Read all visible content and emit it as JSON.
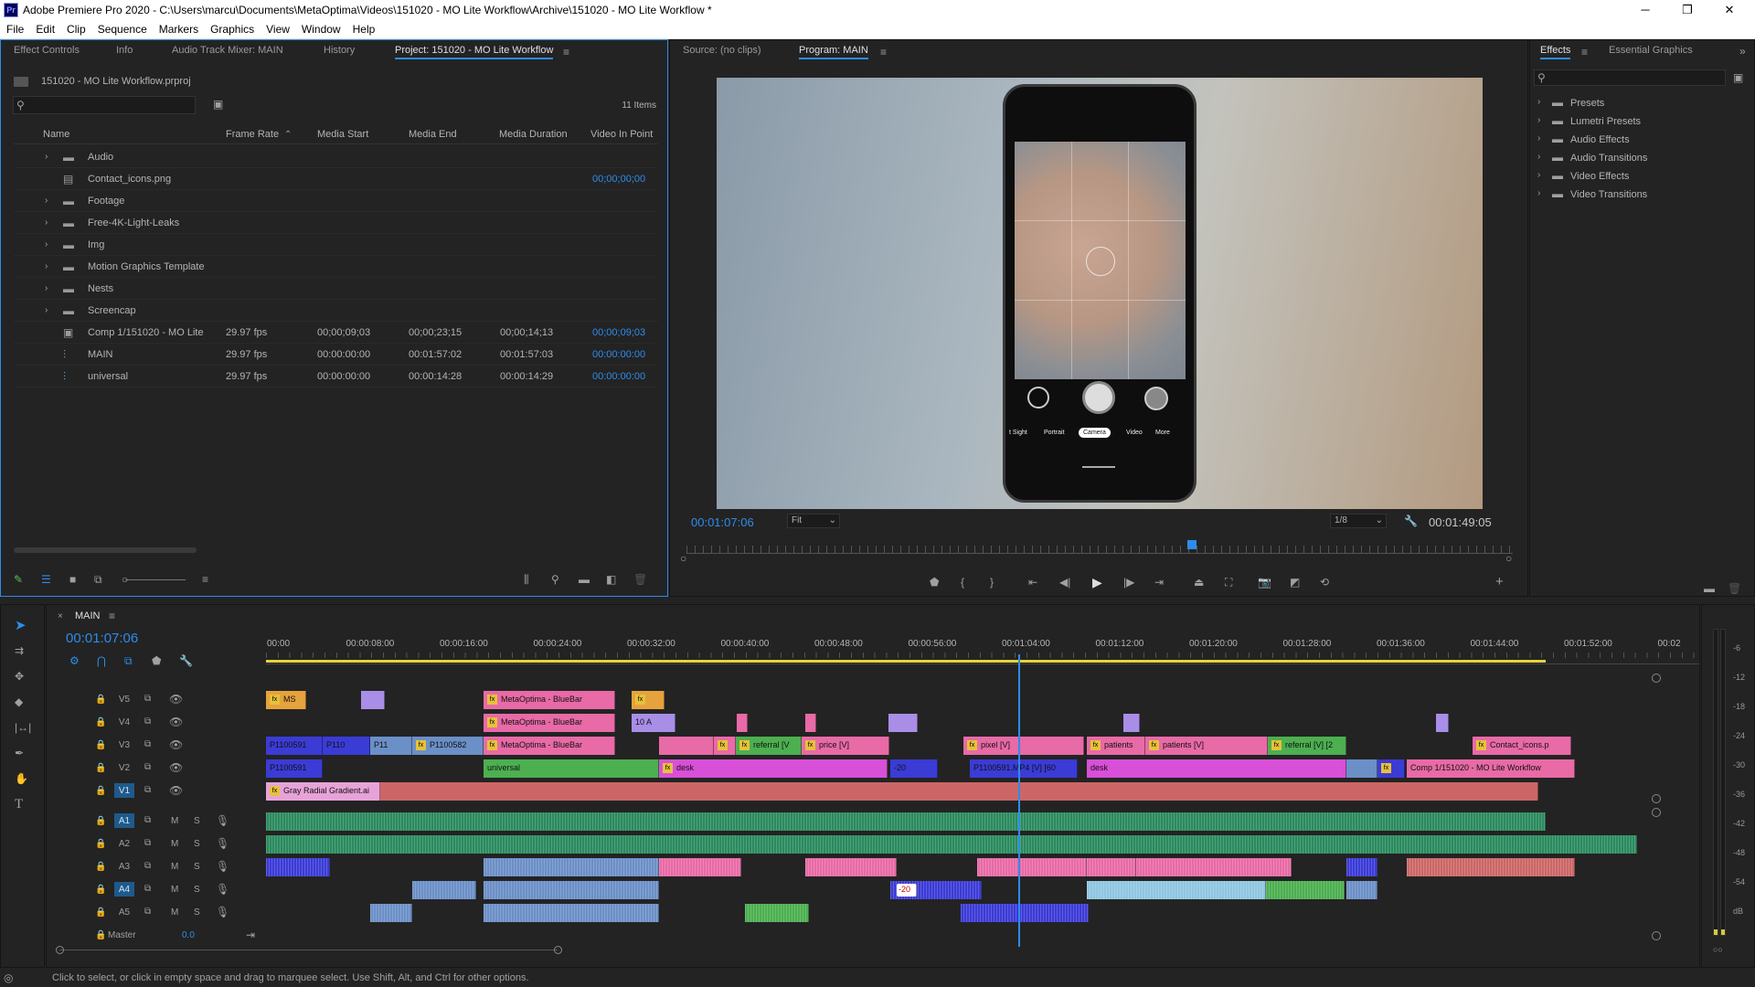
{
  "titlebar": {
    "app_icon": "Pr",
    "title": "Adobe Premiere Pro 2020 - C:\\Users\\marcu\\Documents\\MetaOptima\\Videos\\151020 - MO Lite Workflow\\Archive\\151020 - MO Lite Workflow *",
    "minimize": "─",
    "maximize": "❐",
    "close": "✕"
  },
  "menu": [
    "File",
    "Edit",
    "Clip",
    "Sequence",
    "Markers",
    "Graphics",
    "View",
    "Window",
    "Help"
  ],
  "left_panel": {
    "tabs": [
      "Effect Controls",
      "Info",
      "Audio Track Mixer: MAIN",
      "History",
      "Project: 151020 - MO Lite Workflow"
    ],
    "active_tab": "Project: 151020 - MO Lite Workflow",
    "project_file": "151020 - MO Lite Workflow.prproj",
    "search_placeholder": "",
    "item_count": "11 Items",
    "columns": [
      "Name",
      "Frame Rate",
      "Media Start",
      "Media End",
      "Media Duration",
      "Video In Point"
    ],
    "rows": [
      {
        "name": "Audio",
        "type": "folder",
        "frame_rate": "",
        "start": "",
        "end": "",
        "duration": "",
        "in_point": ""
      },
      {
        "name": "Contact_icons.png",
        "type": "image",
        "frame_rate": "",
        "start": "",
        "end": "",
        "duration": "",
        "in_point": "00;00;00;00"
      },
      {
        "name": "Footage",
        "type": "folder",
        "frame_rate": "",
        "start": "",
        "end": "",
        "duration": "",
        "in_point": ""
      },
      {
        "name": "Free-4K-Light-Leaks",
        "type": "folder",
        "frame_rate": "",
        "start": "",
        "end": "",
        "duration": "",
        "in_point": ""
      },
      {
        "name": "Img",
        "type": "folder",
        "frame_rate": "",
        "start": "",
        "end": "",
        "duration": "",
        "in_point": ""
      },
      {
        "name": "Motion Graphics Template",
        "type": "folder",
        "frame_rate": "",
        "start": "",
        "end": "",
        "duration": "",
        "in_point": ""
      },
      {
        "name": "Nests",
        "type": "folder",
        "frame_rate": "",
        "start": "",
        "end": "",
        "duration": "",
        "in_point": ""
      },
      {
        "name": "Screencap",
        "type": "folder",
        "frame_rate": "",
        "start": "",
        "end": "",
        "duration": "",
        "in_point": ""
      },
      {
        "name": "Comp 1/151020 - MO Lite",
        "type": "comp",
        "frame_rate": "29.97 fps",
        "start": "00;00;09;03",
        "end": "00;00;23;15",
        "duration": "00;00;14;13",
        "in_point": "00;00;09;03"
      },
      {
        "name": "MAIN",
        "type": "sequence",
        "frame_rate": "29.97 fps",
        "start": "00:00:00:00",
        "end": "00:01:57:02",
        "duration": "00:01:57:03",
        "in_point": "00:00:00:00"
      },
      {
        "name": "universal",
        "type": "sequence",
        "frame_rate": "29.97 fps",
        "start": "00:00:00:00",
        "end": "00:00:14:28",
        "duration": "00:00:14:29",
        "in_point": "00:00:00:00"
      }
    ]
  },
  "program": {
    "tabs": [
      "Source: (no clips)",
      "Program: MAIN"
    ],
    "active_tab": "Program: MAIN",
    "timecode": "00:01:07:06",
    "fit": "Fit",
    "resolution": "1/8",
    "duration": "00:01:49:05",
    "phone_modes": [
      "t Sight",
      "Portrait",
      "Camera",
      "Video",
      "More"
    ],
    "playhead_fraction": 0.612
  },
  "effects": {
    "tabs": [
      "Effects",
      "Essential Graphics"
    ],
    "active_tab": "Effects",
    "items": [
      "Presets",
      "Lumetri Presets",
      "Audio Effects",
      "Audio Transitions",
      "Video Effects",
      "Video Transitions"
    ]
  },
  "timeline": {
    "sequence": "MAIN",
    "timecode": "00:01:07:06",
    "ruler": [
      "00:00",
      "00:00:08:00",
      "00:00:16:00",
      "00:00:24:00",
      "00:00:32:00",
      "00:00:40:00",
      "00:00:48:00",
      "00:00:56:00",
      "00:01:04:00",
      "00:01:12:00",
      "00:01:20:00",
      "00:01:28:00",
      "00:01:36:00",
      "00:01:44:00",
      "00:01:52:00",
      "00:02"
    ],
    "video_tracks": [
      "V5",
      "V4",
      "V3",
      "V2",
      "V1"
    ],
    "audio_tracks": [
      "A1",
      "A2",
      "A3",
      "A4",
      "A5"
    ],
    "master_label": "Master",
    "master_value": "0.0",
    "clips": {
      "v5_ms": "MS",
      "v5_bluebar": "MetaOptima - BlueBar",
      "v4_bluebar": "MetaOptima - BlueBar",
      "v4_10a": "10 A",
      "v3_p1": "P1100591",
      "v3_p2": "P110",
      "v3_p3": "P11",
      "v3_p4": "P1100582",
      "v3_bluebar": "MetaOptima - BlueBar",
      "v3_referral": "referral [V",
      "v3_price": "price [V]",
      "v3_pixel": "pixel [V]",
      "v3_patients1": "patients",
      "v3_patients2": "patients [V]",
      "v3_referral2": "referral [V] [2",
      "v3_contact": "Contact_icons.p",
      "v2_p1": "P1100591",
      "v2_universal": "universal",
      "v2_desk": "desk",
      "v2_label20": "-20",
      "v2_p2": "P1100591.MP4 [V] [60",
      "v2_desk2": "desk",
      "v2_comp": "Comp 1/151020 - MO Lite Workflow",
      "v1_gradient": "Gray Radial Gradient.ai",
      "a4_label20": "-20"
    }
  },
  "meter_scale": [
    "-6",
    "-12",
    "-18",
    "-24",
    "-30",
    "-36",
    "-42",
    "-48",
    "-54",
    "dB"
  ],
  "status": "Click to select, or click in empty space and drag to marquee select. Use Shift, Alt, and Ctrl for other options.",
  "colors": {
    "accent": "#2d8ceb",
    "pink": "#e86aa6",
    "magenta": "#d84fd8",
    "green": "#4caf50",
    "lavender": "#a88ee6",
    "orange": "#e6a23c",
    "blueclip": "#3b3bd6",
    "salmon": "#cc6666",
    "audio_green": "#2b8a5e"
  }
}
